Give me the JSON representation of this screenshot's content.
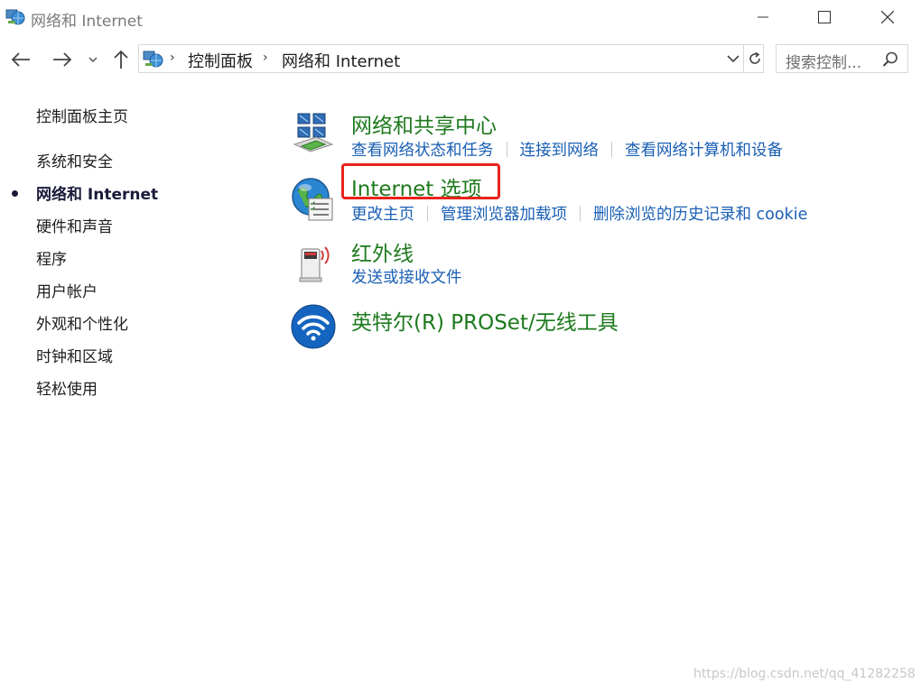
{
  "window": {
    "title": "网络和 Internet",
    "icon": "network-globe-icon"
  },
  "navigation": {
    "back_icon": "arrow-left-icon",
    "forward_icon": "arrow-right-icon",
    "recent_icon": "chevron-down-icon",
    "up_icon": "arrow-up-icon"
  },
  "address": {
    "crumbs": [
      "控制面板",
      "网络和 Internet"
    ],
    "dropdown_icon": "chevron-down-icon",
    "refresh_icon": "refresh-icon"
  },
  "search": {
    "placeholder": "搜索控制...",
    "icon": "search-icon"
  },
  "sidebar": {
    "items": [
      {
        "label": "控制面板主页",
        "active": false
      },
      {
        "label": "系统和安全",
        "active": false
      },
      {
        "label": "网络和 Internet",
        "active": true
      },
      {
        "label": "硬件和声音",
        "active": false
      },
      {
        "label": "程序",
        "active": false
      },
      {
        "label": "用户帐户",
        "active": false
      },
      {
        "label": "外观和个性化",
        "active": false
      },
      {
        "label": "时钟和区域",
        "active": false
      },
      {
        "label": "轻松使用",
        "active": false
      }
    ]
  },
  "categories": [
    {
      "title": "网络和共享中心",
      "icon": "network-sharing-center-icon",
      "links": [
        "查看网络状态和任务",
        "连接到网络",
        "查看网络计算机和设备"
      ]
    },
    {
      "title": "Internet 选项",
      "icon": "internet-options-globe-icon",
      "links": [
        "更改主页",
        "管理浏览器加载项",
        "删除浏览的历史记录和 cookie"
      ],
      "highlighted": true
    },
    {
      "title": "红外线",
      "icon": "infrared-device-icon",
      "links": [
        "发送或接收文件"
      ]
    },
    {
      "title": "英特尔(R) PROSet/无线工具",
      "icon": "intel-wireless-icon",
      "links": []
    }
  ],
  "watermark": "https://blog.csdn.net/qq_41282258",
  "colors": {
    "category_title": "#1e7a1e",
    "link": "#1a5fb4",
    "highlight_border": "#e8231c"
  }
}
